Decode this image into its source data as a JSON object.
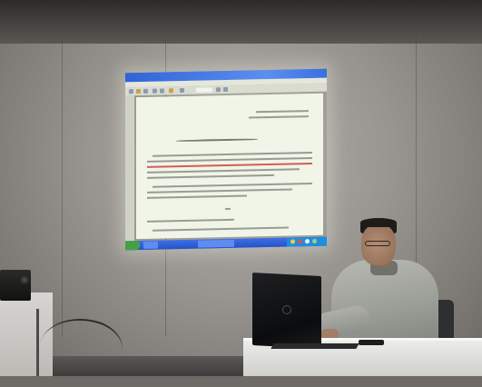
{
  "scene": {
    "description_colors": {
      "wall": "#a8a49f",
      "projection_bg": "#f1f5e8",
      "taskbar": "#2f5fd6",
      "accent_red_text": "#c82828"
    }
  },
  "projection": {
    "window_title": "",
    "menu": ""
  }
}
